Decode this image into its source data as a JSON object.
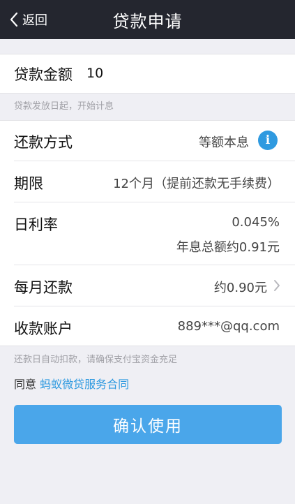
{
  "nav": {
    "back_label": "返回",
    "title": "贷款申请"
  },
  "loan": {
    "amount_label": "贷款金额",
    "amount_value": "10",
    "amount_hint": "贷款发放日起，开始计息"
  },
  "details": {
    "repay_method_label": "还款方式",
    "repay_method_value": "等额本息",
    "term_label": "期限",
    "term_value": "12个月（提前还款无手续费）",
    "rate_label": "日利率",
    "rate_value": "0.045%",
    "total_interest": "年息总额约0.91元",
    "monthly_label": "每月还款",
    "monthly_value": "约0.90元",
    "account_label": "收款账户",
    "account_value": "889***@qq.com"
  },
  "footer": {
    "auto_debit_hint": "还款日自动扣款，请确保支付宝资金充足",
    "agree_prefix": "同意",
    "agreement_link": "蚂蚁微贷服务合同",
    "confirm_label": "确认使用"
  },
  "icons": {
    "back": "chevron-left-icon",
    "info": "info-icon",
    "monthly_arrow": "chevron-right-icon"
  },
  "colors": {
    "navbar": "#24262f",
    "accent": "#2f9ae0",
    "button": "#4aa6ea",
    "background": "#efeff4"
  }
}
